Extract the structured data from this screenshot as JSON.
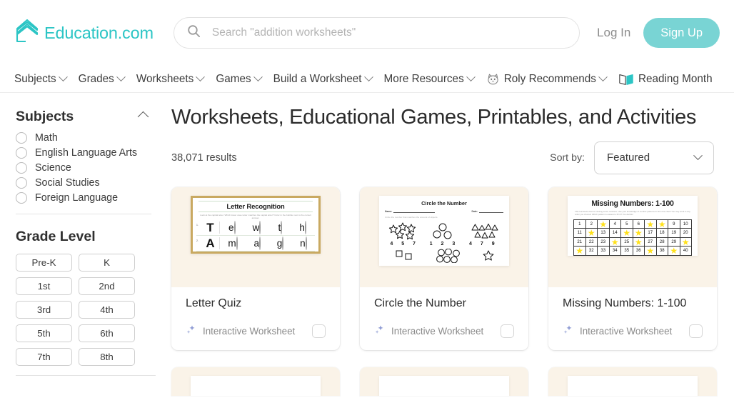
{
  "header": {
    "brand": "Education.com",
    "brand_color": "#2cc5c5",
    "search_placeholder": "Search \"addition worksheets\"",
    "search_value": "",
    "search_icon": "search-icon",
    "login_label": "Log In",
    "signup_label": "Sign Up",
    "signup_color": "#79d4d4"
  },
  "nav": {
    "items": [
      {
        "label": "Subjects",
        "caret": true,
        "icon": null
      },
      {
        "label": "Grades",
        "caret": true,
        "icon": null
      },
      {
        "label": "Worksheets",
        "caret": true,
        "icon": null
      },
      {
        "label": "Games",
        "caret": true,
        "icon": null
      },
      {
        "label": "Build a Worksheet",
        "caret": true,
        "icon": null
      },
      {
        "label": "More Resources",
        "caret": true,
        "icon": null
      },
      {
        "label": "Roly Recommends",
        "caret": true,
        "icon": "roly-mascot-icon"
      },
      {
        "label": "Reading Month",
        "caret": false,
        "icon": "open-book-icon"
      }
    ]
  },
  "sidebar": {
    "subjects": {
      "title": "Subjects",
      "collapse_icon": "chevron-up-icon",
      "options": [
        "Math",
        "English Language Arts",
        "Science",
        "Social Studies",
        "Foreign Language"
      ]
    },
    "grade_level": {
      "title": "Grade Level",
      "options": [
        "Pre-K",
        "K",
        "1st",
        "2nd",
        "3rd",
        "4th",
        "5th",
        "6th",
        "7th",
        "8th"
      ]
    }
  },
  "main": {
    "page_title": "Worksheets, Educational Games, Printables, and Activities",
    "results_count": "38,071 results",
    "sort": {
      "label": "Sort by:",
      "value": "Featured",
      "caret_icon": "chevron-down-icon"
    },
    "cards": [
      {
        "title": "Letter Quiz",
        "meta": "Interactive Worksheet",
        "meta_icon": "sparkle-icon",
        "thumb_type": "letter-recognition",
        "worksheet": {
          "title": "Letter Recognition",
          "instructions": "Look at the capital letter. Which lower case letter matches the capital letter? Color in the bubble next to the correct answer.",
          "rows": [
            {
              "num": "1.",
              "capital": "T",
              "options": [
                "e",
                "w",
                "t",
                "h"
              ]
            },
            {
              "num": "2.",
              "capital": "A",
              "options": [
                "m",
                "a",
                "g",
                "n"
              ]
            }
          ]
        }
      },
      {
        "title": "Circle the Number",
        "meta": "Interactive Worksheet",
        "meta_icon": "sparkle-icon",
        "thumb_type": "circle-the-number",
        "worksheet": {
          "title": "Circle the Number",
          "name_field": "Name:",
          "date_field": "Date:",
          "instructions": "Circle the number that matches the amount of objects.",
          "groups": [
            {
              "shape": "star",
              "count": 5,
              "choices": "4 5 7"
            },
            {
              "shape": "circle",
              "count": 3,
              "choices": "1 2 3"
            },
            {
              "shape": "triangle",
              "count": 7,
              "choices": "4 7 9"
            }
          ],
          "bottom_groups": [
            {
              "shape": "square",
              "count": 2
            },
            {
              "shape": "circle",
              "count": 6
            },
            {
              "shape": "star",
              "count": 1
            }
          ]
        }
      },
      {
        "title": "Missing Numbers: 1-100",
        "meta": "Interactive Worksheet",
        "meta_icon": "sparkle-icon",
        "thumb_type": "missing-numbers",
        "worksheet": {
          "title": "Missing Numbers: 1-100",
          "instructions": "This hundreds chart is missing some numbers. Use your knowledge of number patterns to fill in the chart! You may work in any order you choose! Which pattern is easiest to fill in? You decide!",
          "star_color": "#ffe11a",
          "grid": [
            [
              "1",
              "2",
              "*",
              "4",
              "5",
              "6",
              "*",
              "*",
              "9",
              "10"
            ],
            [
              "11",
              "*",
              "13",
              "14",
              "*",
              "*",
              "17",
              "18",
              "19",
              "20"
            ],
            [
              "21",
              "22",
              "23",
              "*",
              "25",
              "*",
              "27",
              "28",
              "29",
              "*"
            ],
            [
              "*",
              "32",
              "33",
              "34",
              "35",
              "36",
              "*",
              "38",
              "*",
              "40"
            ]
          ]
        }
      }
    ],
    "partial_cards": [
      {
        "thumb_type": "partial"
      },
      {
        "thumb_type": "partial"
      },
      {
        "thumb_type": "partial"
      }
    ]
  }
}
